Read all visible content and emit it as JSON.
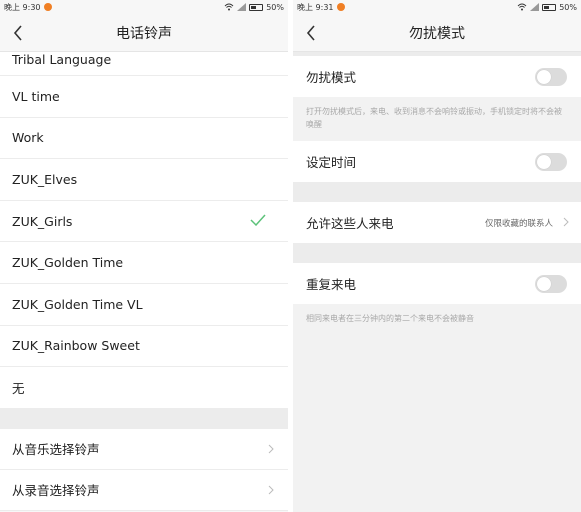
{
  "left": {
    "status": {
      "time": "晚上 9:30",
      "battery": "50%"
    },
    "nav": {
      "title": "电话铃声"
    },
    "ringtones": [
      {
        "label": "Tribal Language",
        "selected": false
      },
      {
        "label": "VL time",
        "selected": false
      },
      {
        "label": "Work",
        "selected": false
      },
      {
        "label": "ZUK_Elves",
        "selected": false
      },
      {
        "label": "ZUK_Girls",
        "selected": true
      },
      {
        "label": "ZUK_Golden Time",
        "selected": false
      },
      {
        "label": "ZUK_Golden Time VL",
        "selected": false
      },
      {
        "label": "ZUK_Rainbow Sweet",
        "selected": false
      },
      {
        "label": "无",
        "selected": false
      }
    ],
    "pickers": [
      {
        "label": "从音乐选择铃声"
      },
      {
        "label": "从录音选择铃声"
      }
    ],
    "colors": {
      "check": "#5cc27a"
    }
  },
  "right": {
    "status": {
      "time": "晚上 9:31",
      "battery": "50%"
    },
    "nav": {
      "title": "勿扰模式"
    },
    "dnd": {
      "label": "勿扰模式",
      "enabled": false,
      "description": "打开勿扰模式后，来电、收到消息不会响铃或振动，手机锁定时将不会被唤醒"
    },
    "schedule": {
      "label": "设定时间",
      "enabled": false
    },
    "allow_calls": {
      "label": "允许这些人来电",
      "value": "仅限收藏的联系人"
    },
    "repeat_calls": {
      "label": "重复来电",
      "enabled": false,
      "description": "相同来电者在三分钟内的第二个来电不会被静音"
    }
  }
}
